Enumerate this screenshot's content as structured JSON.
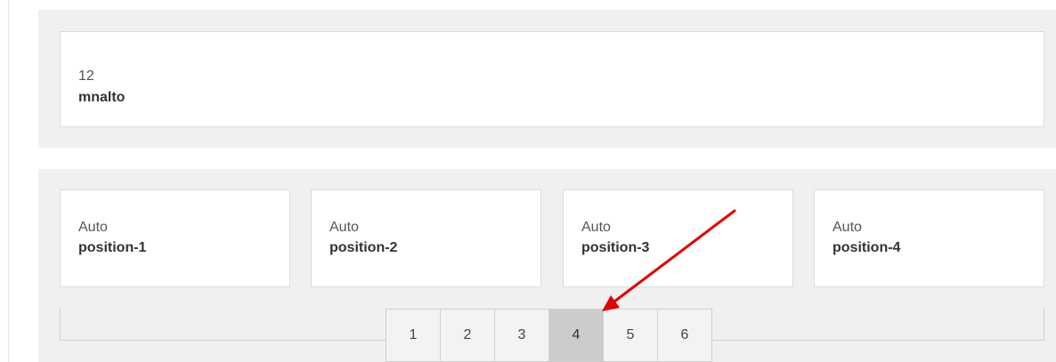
{
  "main_card": {
    "number": "12",
    "name": "mnalto"
  },
  "positions": [
    {
      "type": "Auto",
      "name": "position-1"
    },
    {
      "type": "Auto",
      "name": "position-2"
    },
    {
      "type": "Auto",
      "name": "position-3"
    },
    {
      "type": "Auto",
      "name": "position-4"
    }
  ],
  "pagination": {
    "pages": [
      "1",
      "2",
      "3",
      "4",
      "5",
      "6"
    ],
    "active": "4"
  },
  "colors": {
    "annotation_arrow": "#e00000",
    "active_page": "#cccccc",
    "panel": "#f0f0f0"
  }
}
